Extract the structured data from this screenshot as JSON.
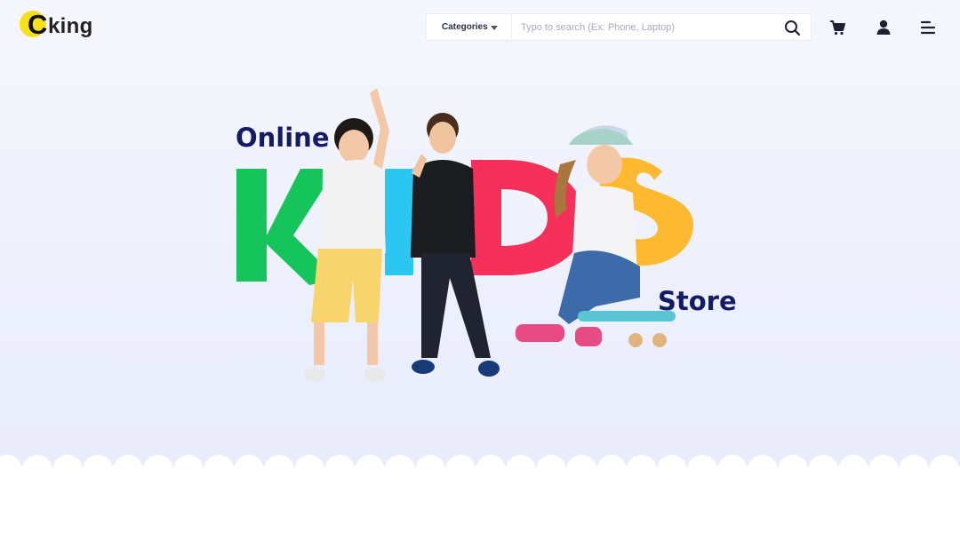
{
  "brand": {
    "logo_letter": "C",
    "logo_text": "king",
    "logo_circle_color": "#f5e11a"
  },
  "search": {
    "category_label": "Categories",
    "placeholder": "Typo to search (Ex: Phone, Laptop)",
    "value": ""
  },
  "header_icons": [
    "cart-icon",
    "user-icon",
    "menu-icon"
  ],
  "hero": {
    "top_word": "Online",
    "letters": [
      {
        "char": "K",
        "color": "#16c45c"
      },
      {
        "char": "I",
        "color": "#2cc6f2"
      },
      {
        "char": "D",
        "color": "#f5305a"
      },
      {
        "char": "S",
        "color": "#fdb92f"
      }
    ],
    "bottom_word": "Store",
    "text_color": "#141a63"
  }
}
